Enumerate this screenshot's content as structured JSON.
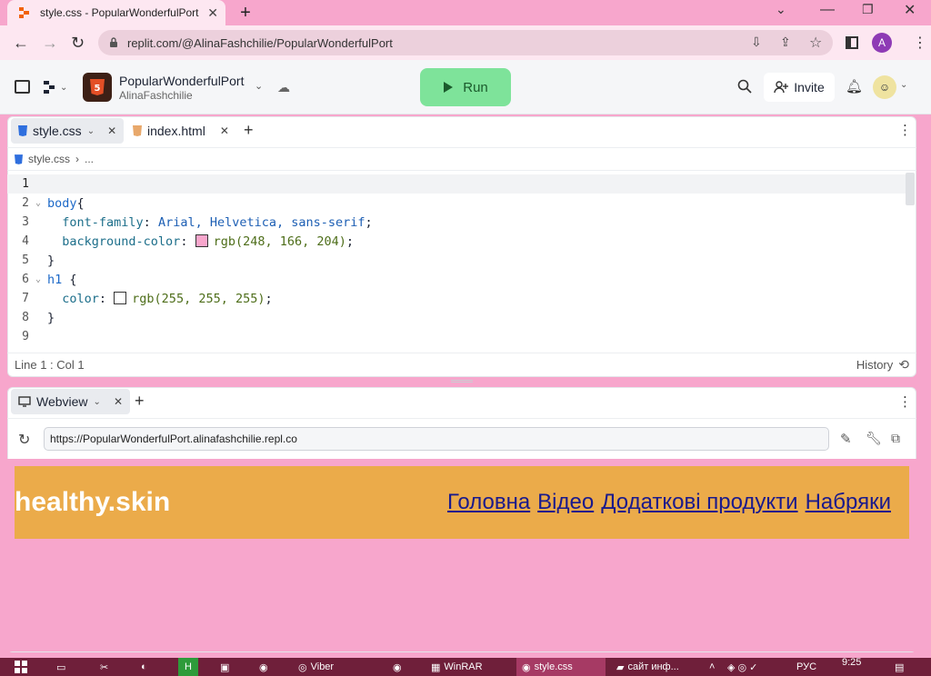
{
  "browser": {
    "tab_title": "style.css - PopularWonderfulPort",
    "url": "replit.com/@AlinaFashchilie/PopularWonderfulPort",
    "profile_initial": "A"
  },
  "replit": {
    "repl_name": "PopularWonderfulPort",
    "owner": "AlinaFashchilie",
    "run_label": "Run",
    "invite_label": "Invite"
  },
  "editor": {
    "tabs": [
      {
        "label": "style.css"
      },
      {
        "label": "index.html"
      }
    ],
    "breadcrumb": {
      "file": "style.css",
      "more": "..."
    },
    "lines": [
      "1",
      "2",
      "3",
      "4",
      "5",
      "6",
      "7",
      "8",
      "9"
    ],
    "code": {
      "l2_selector": "body",
      "l2_brace": "{",
      "l3_prop": "font-family",
      "l3_val": "Arial, Helvetica, sans-serif",
      "l4_prop": "background-color",
      "l4_val": "rgb(248, 166, 204)",
      "l5": "}",
      "l6_selector": "h1",
      "l6_brace": " {",
      "l7_prop": "color",
      "l7_val": "rgb(255, 255, 255)",
      "l8": "}"
    },
    "swatch_colors": [
      "#f8a6cc",
      "#ffffff"
    ],
    "cursor_pos": "Line 1 : Col 1",
    "history_label": "History"
  },
  "webview": {
    "tab_label": "Webview",
    "url": "https://PopularWonderfulPort.alinafashchilie.repl.co",
    "site": {
      "logo": "healthy.skin",
      "nav": [
        "Головна",
        "Відео",
        "Додаткові продукти",
        "Набряки"
      ]
    }
  },
  "taskbar": {
    "items": [
      "Viber",
      "WinRAR",
      "style.css",
      "сайт инф..."
    ],
    "lang": "РУС",
    "time": "9:25"
  },
  "colors": {
    "accent_pink": "#f7a6cc",
    "run_green": "#7ee39a",
    "site_header": "#ebab4a"
  }
}
